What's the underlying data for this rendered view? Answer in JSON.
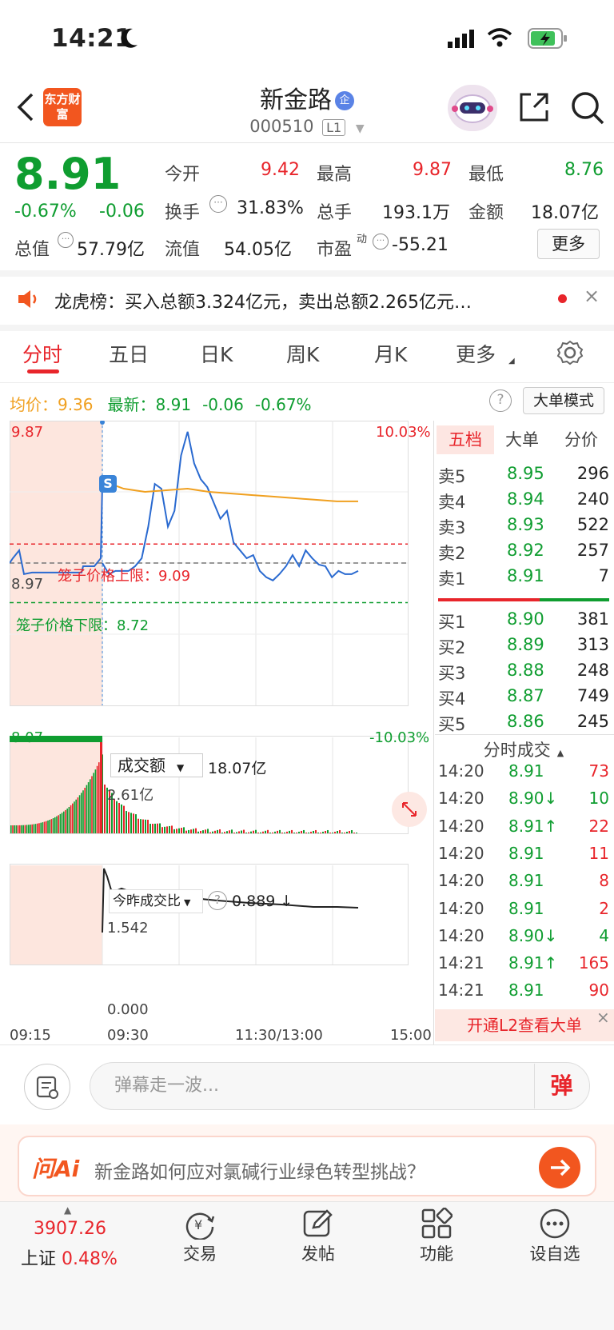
{
  "status": {
    "time": "14:21"
  },
  "header": {
    "logo_text": "东方财富",
    "title": "新金路",
    "badge": "企",
    "code": "000510",
    "level": "L1"
  },
  "quote": {
    "price": "8.91",
    "change_pct": "-0.67%",
    "change": "-0.06",
    "open_label": "今开",
    "open": "9.42",
    "high_label": "最高",
    "high": "9.87",
    "low_label": "最低",
    "low": "8.76",
    "turnover_label": "换手",
    "turnover": "31.83%",
    "volume_label": "总手",
    "volume": "193.1万",
    "amount_label": "金额",
    "amount": "18.07亿",
    "mktcap_label": "总值",
    "mktcap": "57.79亿",
    "float_label": "流值",
    "float": "54.05亿",
    "pe_label": "市盈",
    "pe_sup": "动",
    "pe": "-55.21",
    "more": "更多"
  },
  "news": {
    "text": "龙虎榜：买入总额3.324亿元，卖出总额2.265亿元…",
    "close": "×"
  },
  "tabs": [
    "分时",
    "五日",
    "日K",
    "周K",
    "月K",
    "更多"
  ],
  "info_row": {
    "avg_label": "均价：",
    "avg": "9.36",
    "latest_label": "最新：",
    "latest": "8.91",
    "change": "-0.06",
    "change_pct": "-0.67%",
    "help": "?",
    "mode": "大单模式"
  },
  "chart_labels": {
    "ymax": "9.87",
    "ymid": "8.97",
    "ymin": "8.07",
    "pmax": "10.03%",
    "pmin": "-10.03%",
    "upper_limit": "笼子价格上限：9.09",
    "lower_limit": "笼子价格下限：8.72",
    "s_badge": "S",
    "vol_select": "成交额",
    "vol_total": "18.07亿",
    "vol_max": "2.61亿",
    "ratio_select": "今昨成交比",
    "ratio_help": "?",
    "ratio_value": "0.889 ↓",
    "ratio_max": "1.542",
    "ratio_min": "0.000",
    "t0": "09:15",
    "t1": "09:30",
    "t2": "11:30/13:00",
    "t3": "15:00"
  },
  "chart_data": {
    "type": "line",
    "x_times": [
      "09:15",
      "09:30",
      "11:30/13:00",
      "15:00"
    ],
    "ylim": [
      8.07,
      9.87
    ],
    "reference_price": 8.97,
    "price_limits_pct": [
      -10.03,
      10.03
    ],
    "cage_upper": 9.09,
    "cage_lower": 8.72,
    "series": [
      {
        "values": [
          8.97,
          8.9,
          8.92,
          8.92,
          8.92,
          8.95,
          9.0,
          9.2,
          9.47,
          9.44,
          9.2,
          9.3,
          9.65,
          9.8,
          9.6,
          9.5,
          9.45,
          9.35,
          9.25,
          9.3,
          9.1,
          9.05,
          9.0,
          9.02,
          8.92,
          8.88,
          8.86,
          8.9,
          8.95,
          9.02,
          8.95,
          9.05,
          9.0,
          8.96,
          8.95,
          8.88,
          8.92,
          8.9,
          8.9,
          8.92
        ]
      },
      {
        "values": [
          9.49,
          9.44,
          9.42,
          9.43,
          9.44,
          9.42,
          9.41,
          9.4,
          9.39,
          9.38,
          9.37,
          9.36,
          9.36
        ]
      }
    ],
    "volume_max": "2.61亿",
    "ratio_range": [
      0.0,
      1.542
    ]
  },
  "order_book": {
    "tabs": [
      "五档",
      "大单",
      "分价"
    ],
    "asks": [
      {
        "label": "卖5",
        "price": "8.95",
        "vol": "296"
      },
      {
        "label": "卖4",
        "price": "8.94",
        "vol": "240"
      },
      {
        "label": "卖3",
        "price": "8.93",
        "vol": "522"
      },
      {
        "label": "卖2",
        "price": "8.92",
        "vol": "257"
      },
      {
        "label": "卖1",
        "price": "8.91",
        "vol": "7"
      }
    ],
    "bids": [
      {
        "label": "买1",
        "price": "8.90",
        "vol": "381"
      },
      {
        "label": "买2",
        "price": "8.89",
        "vol": "313"
      },
      {
        "label": "买3",
        "price": "8.88",
        "vol": "248"
      },
      {
        "label": "买4",
        "price": "8.87",
        "vol": "749"
      },
      {
        "label": "买5",
        "price": "8.86",
        "vol": "245"
      }
    ]
  },
  "ticks": {
    "title": "分时成交",
    "rows": [
      {
        "time": "14:20",
        "price": "8.91",
        "vol": "73",
        "dir": ""
      },
      {
        "time": "14:20",
        "price": "8.90↓",
        "vol": "10",
        "dir": "down"
      },
      {
        "time": "14:20",
        "price": "8.91↑",
        "vol": "22",
        "dir": "up"
      },
      {
        "time": "14:20",
        "price": "8.91",
        "vol": "11",
        "dir": ""
      },
      {
        "time": "14:20",
        "price": "8.91",
        "vol": "8",
        "dir": ""
      },
      {
        "time": "14:20",
        "price": "8.91",
        "vol": "2",
        "dir": ""
      },
      {
        "time": "14:20",
        "price": "8.90↓",
        "vol": "4",
        "dir": "down"
      },
      {
        "time": "14:21",
        "price": "8.91↑",
        "vol": "165",
        "dir": "up"
      },
      {
        "time": "14:21",
        "price": "8.91",
        "vol": "90",
        "dir": ""
      }
    ],
    "l2_btn": "开通L2查看大单",
    "l2_close": "×"
  },
  "danmu": {
    "placeholder": "弹幕走一波...",
    "btn": "弹"
  },
  "ai": {
    "logo": "问Ai",
    "text": "新金路如何应对氯碱行业绿色转型挑战？"
  },
  "nav": {
    "index_value": "3907.26",
    "index_name": "上证",
    "index_pct": "0.48%",
    "items": [
      "交易",
      "发帖",
      "功能",
      "设自选"
    ]
  },
  "colors": {
    "up": "#e8252b",
    "down": "#0f9d30",
    "price_line": "#2a6ad0",
    "avg_line": "#f0a020",
    "brand": "#f2561f"
  }
}
